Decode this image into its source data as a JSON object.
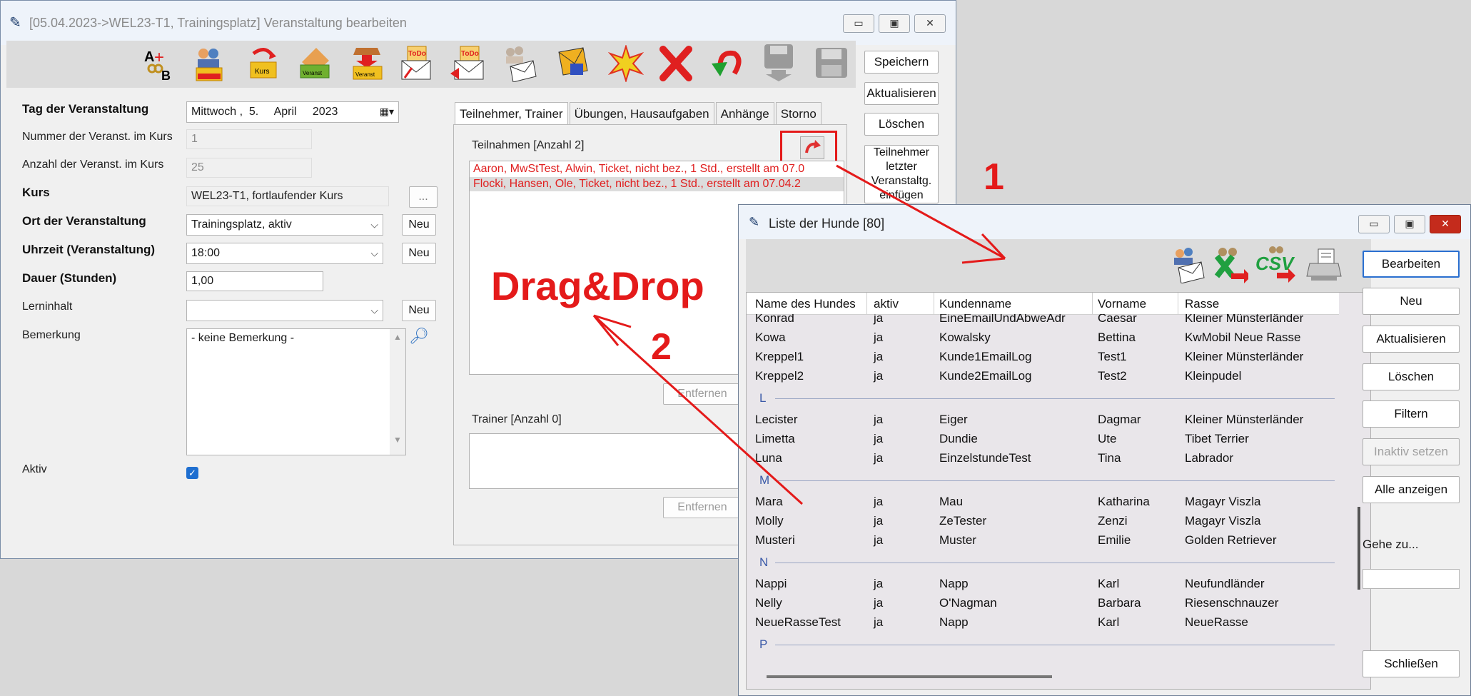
{
  "main_window": {
    "title": "[05.04.2023->WEL23-T1, Trainingsplatz] Veranstaltung bearbeiten",
    "controls": [
      "▭",
      "▣",
      "✕"
    ],
    "toolbar_icons": [
      "add-veranstaltung-icon",
      "veranstaltung-kurs-icon",
      "kurs-icon",
      "veranstaltung-icon",
      "veranstaltung-move-icon",
      "todo-mail-icon",
      "todo-send-icon",
      "people-mail-icon",
      "mail-icon",
      "new-icon",
      "delete-icon",
      "undo-icon",
      "save-disabled-icon",
      "save-icon"
    ],
    "toolbar_text": {
      "a_plus": "A",
      "b": "B",
      "todo": "ToDo",
      "veranst": "Veranst",
      "kurs": "Kurs"
    },
    "side_buttons": {
      "speichern": "Speichern",
      "aktualisieren": "Aktualisieren",
      "loeschen": "Löschen",
      "teilnehmer_insert": "Teilnehmer letzter Veranstaltg. einfügen"
    },
    "form": {
      "tag_label": "Tag der Veranstaltung",
      "tag_value": "Mittwoch ,  5.     April     2023",
      "nummer_label": "Nummer der Veranst. im Kurs",
      "nummer_value": "1",
      "anzahl_label": "Anzahl der Veranst. im Kurs",
      "anzahl_value": "25",
      "kurs_label": "Kurs",
      "kurs_value": "WEL23-T1, fortlaufender Kurs",
      "kurs_btn": "...",
      "ort_label": "Ort der Veranstaltung",
      "ort_value": "Trainingsplatz, aktiv",
      "uhrzeit_label": "Uhrzeit (Veranstaltung)",
      "uhrzeit_value": "18:00",
      "dauer_label": "Dauer (Stunden)",
      "dauer_value": "1,00",
      "lerninhalt_label": "Lerninhalt",
      "lerninhalt_value": "",
      "bemerkung_label": "Bemerkung",
      "bemerkung_value": "- keine Bemerkung -",
      "aktiv_label": "Aktiv",
      "neu": "Neu"
    },
    "tabs": [
      "Teilnehmer, Trainer",
      "Übungen, Hausaufgaben",
      "Anhänge",
      "Storno"
    ],
    "teilnahmen_label": "Teilnahmen [Anzahl 2]",
    "teilnahmen": [
      "Aaron, MwStTest, Alwin, Ticket, nicht bez., 1 Std., erstellt am 07.0",
      "Flocki, Hansen, Ole, Ticket, nicht bez., 1 Std., erstellt am 07.04.2"
    ],
    "entfernen": "Entfernen",
    "trainer_label": "Trainer [Anzahl 0]"
  },
  "dog_window": {
    "title": "Liste der Hunde [80]",
    "controls": [
      "▭",
      "▣",
      "✕"
    ],
    "toolbar_icons": [
      "people-mail-icon",
      "export-excel-icon",
      "export-csv-icon",
      "print-icon"
    ],
    "csv_text": "CSV",
    "columns": [
      "Name des Hundes",
      "aktiv",
      "Kundenname",
      "Vorname",
      "Rasse"
    ],
    "cut_row": [
      "Konrad",
      "ja",
      "EineEmailUndAbweAdr",
      "Caesar",
      "Kleiner Münsterländer"
    ],
    "groups": [
      {
        "letter": "",
        "rows": [
          [
            "Kowa",
            "ja",
            "Kowalsky",
            "Bettina",
            "KwMobil Neue Rasse"
          ],
          [
            "Kreppel1",
            "ja",
            "Kunde1EmailLog",
            "Test1",
            "Kleiner Münsterländer"
          ],
          [
            "Kreppel2",
            "ja",
            "Kunde2EmailLog",
            "Test2",
            "Kleinpudel"
          ]
        ]
      },
      {
        "letter": "L",
        "rows": [
          [
            "Lecister",
            "ja",
            "Eiger",
            "Dagmar",
            "Kleiner Münsterländer"
          ],
          [
            "Limetta",
            "ja",
            "Dundie",
            "Ute",
            "Tibet Terrier"
          ],
          [
            "Luna",
            "ja",
            "EinzelstundeTest",
            "Tina",
            "Labrador"
          ]
        ]
      },
      {
        "letter": "M",
        "rows": [
          [
            "Mara",
            "ja",
            "Mau",
            "Katharina",
            "Magayr Viszla"
          ],
          [
            "Molly",
            "ja",
            "ZeTester",
            "Zenzi",
            "Magayr Viszla"
          ],
          [
            "Musteri",
            "ja",
            "Muster",
            "Emilie",
            "Golden Retriever"
          ]
        ]
      },
      {
        "letter": "N",
        "rows": [
          [
            "Nappi",
            "ja",
            "Napp",
            "Karl",
            "Neufundländer"
          ],
          [
            "Nelly",
            "ja",
            "O'Nagman",
            "Barbara",
            "Riesenschnauzer"
          ],
          [
            "NeueRasseTest",
            "ja",
            "Napp",
            "Karl",
            "NeueRasse"
          ]
        ]
      },
      {
        "letter": "P",
        "rows": []
      }
    ],
    "buttons": {
      "bearbeiten": "Bearbeiten",
      "neu": "Neu",
      "aktualisieren": "Aktualisieren",
      "loeschen": "Löschen",
      "filtern": "Filtern",
      "inaktiv": "Inaktiv setzen",
      "alle": "Alle anzeigen",
      "gehe_zu": "Gehe zu...",
      "schliessen": "Schließen"
    }
  },
  "annotations": {
    "step1": "1",
    "step2": "2",
    "dragdrop": "Drag&Drop",
    "color": "#e41a1a"
  }
}
